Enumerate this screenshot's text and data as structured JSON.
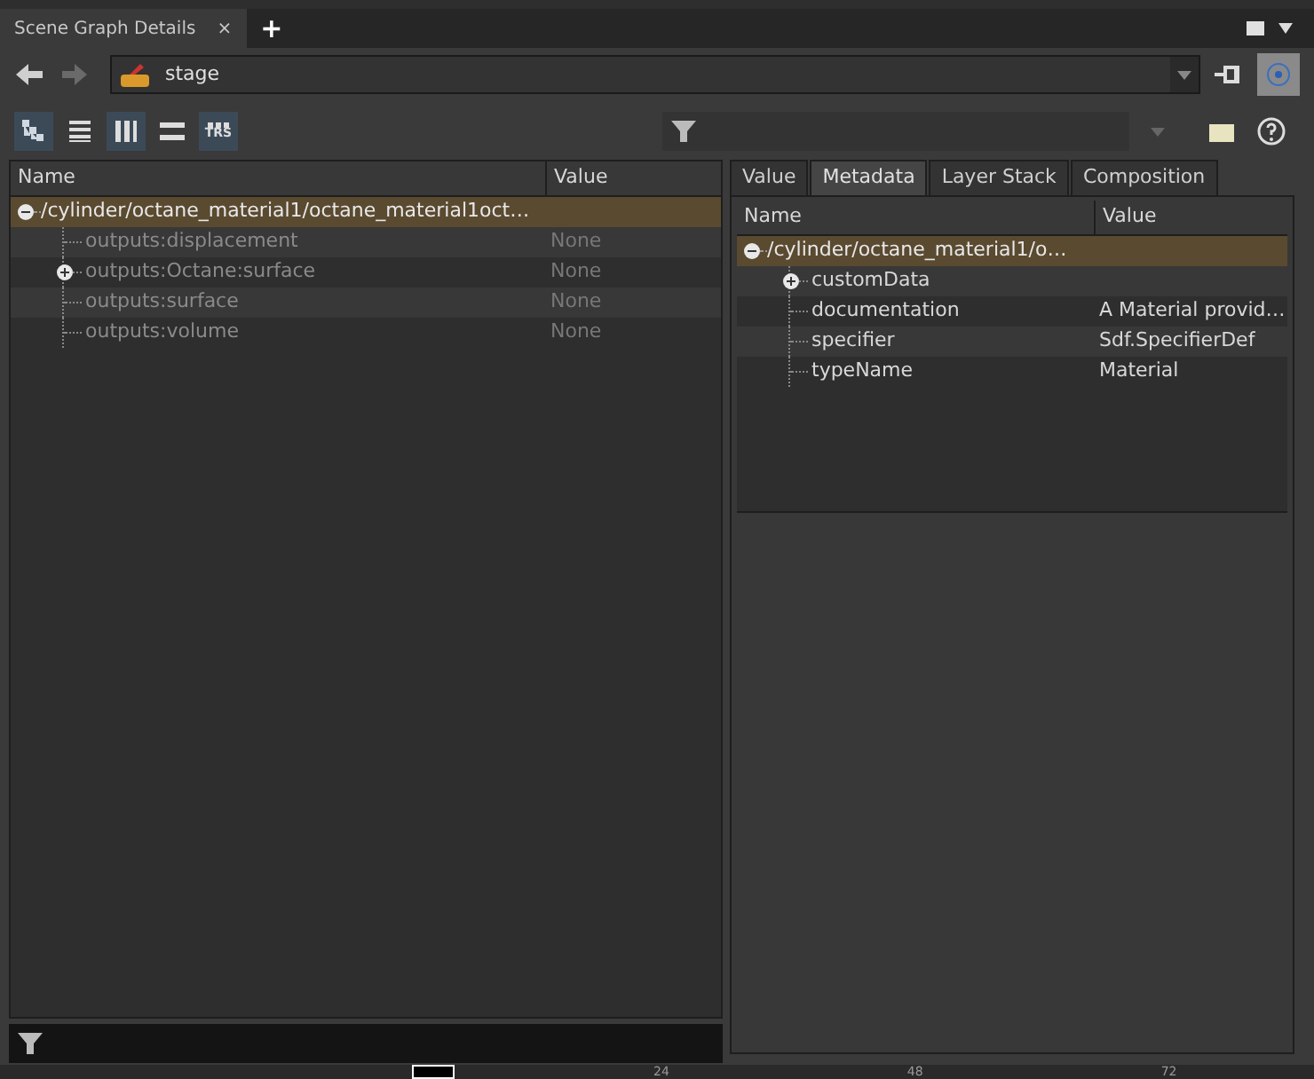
{
  "pane_tab": {
    "title": "Scene Graph Details",
    "close": "×",
    "add": "+"
  },
  "path_field": {
    "value": "stage"
  },
  "view_buttons": [
    {
      "kind": "tree",
      "selected": true
    },
    {
      "kind": "list",
      "selected": false
    },
    {
      "kind": "columns",
      "selected": true
    },
    {
      "kind": "rows",
      "selected": false
    },
    {
      "kind": "trs",
      "label": "TRS",
      "selected": true
    }
  ],
  "left_tree": {
    "columns": [
      "Name",
      "Value"
    ],
    "root": {
      "name": "/cylinder/octane_material1/octane_material1oct…",
      "expanded": true,
      "children": [
        {
          "name": "outputs:displacement",
          "value": "None",
          "expandable": false
        },
        {
          "name": "outputs:Octane:surface",
          "value": "None",
          "expandable": true
        },
        {
          "name": "outputs:surface",
          "value": "None",
          "expandable": false
        },
        {
          "name": "outputs:volume",
          "value": "None",
          "expandable": false
        }
      ]
    }
  },
  "right_tabs": [
    {
      "label": "Value",
      "selected": false
    },
    {
      "label": "Metadata",
      "selected": true
    },
    {
      "label": "Layer Stack",
      "selected": false
    },
    {
      "label": "Composition",
      "selected": false
    }
  ],
  "right_tree": {
    "columns": [
      "Name",
      "Value"
    ],
    "root": {
      "name": "/cylinder/octane_material1/o…",
      "expanded": true,
      "children": [
        {
          "name": "customData",
          "expandable": true
        },
        {
          "name": "documentation",
          "value": "A Material provid…",
          "expandable": false
        },
        {
          "name": "specifier",
          "value": "Sdf.SpecifierDef",
          "expandable": false
        },
        {
          "name": "typeName",
          "value": "Material",
          "expandable": false
        }
      ]
    }
  },
  "timeline": {
    "ticks": [
      "24",
      "48",
      "72"
    ]
  }
}
